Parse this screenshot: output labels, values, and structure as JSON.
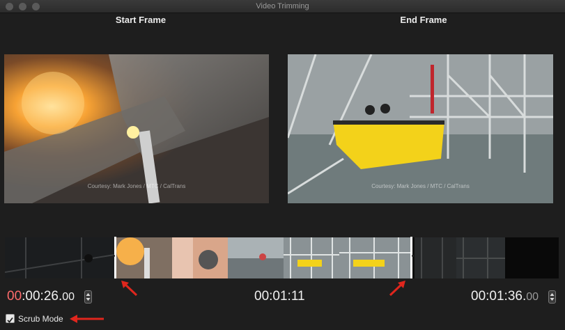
{
  "window": {
    "title": "Video Trimming"
  },
  "labels": {
    "start_frame": "Start Frame",
    "end_frame": "End Frame"
  },
  "start_panel": {
    "credit": "Courtesy: Mark Jones / MTC / CalTrans"
  },
  "end_panel": {
    "credit": "Courtesy: Mark Jones / MTC / CalTrans"
  },
  "timecodes": {
    "start": {
      "hours": "00",
      "rest": ":00:26.",
      "frames": "00"
    },
    "duration": "00:01:11",
    "end": {
      "main": "00:01:36.",
      "frames": "00"
    }
  },
  "scrub_mode": {
    "label": "Scrub Mode",
    "checked": true
  },
  "colors": {
    "accent_red": "#e0261d",
    "start_hours": "#ff6b6b"
  }
}
